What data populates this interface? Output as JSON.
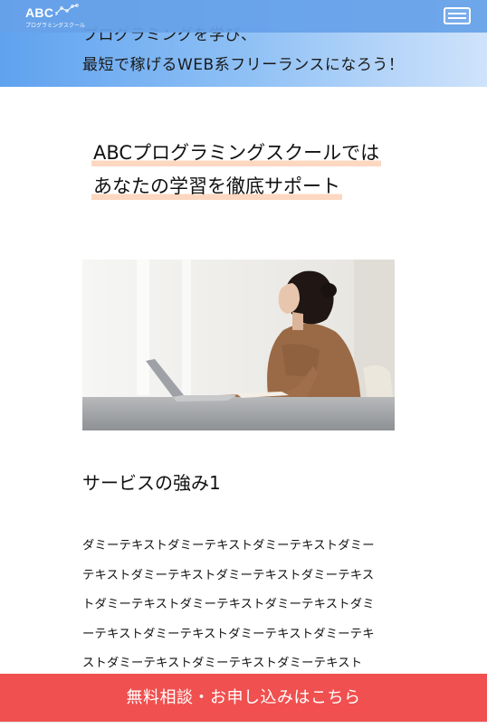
{
  "header": {
    "logo_text": "ABC",
    "logo_subtext": "プログラミングスクール",
    "menu_icon": "hamburger-icon"
  },
  "hero": {
    "line1": "プログラミングを学び、",
    "line2": "最短で稼げるWEB系フリーランスになろう！"
  },
  "intro": {
    "line1": "ABCプログラミングスクールでは",
    "line2": "あなたの学習を徹底サポート"
  },
  "service": {
    "title": "サービスの強み1",
    "body_lines": [
      "ダミーテキストダミーテキストダミーテキストダミー",
      "テキストダミーテキストダミーテキストダミーテキス",
      "トダミーテキストダミーテキストダミーテキストダミ",
      "ーテキストダミーテキストダミーテキストダミーテキ",
      "ストダミーテキストダミーテキストダミーテキスト"
    ]
  },
  "cta": {
    "label": "無料相談・お申し込みはこちら"
  },
  "colors": {
    "header_bg": "#66a1e8",
    "cta_bg": "#f0504f",
    "highlight": "#fcd8c0"
  }
}
